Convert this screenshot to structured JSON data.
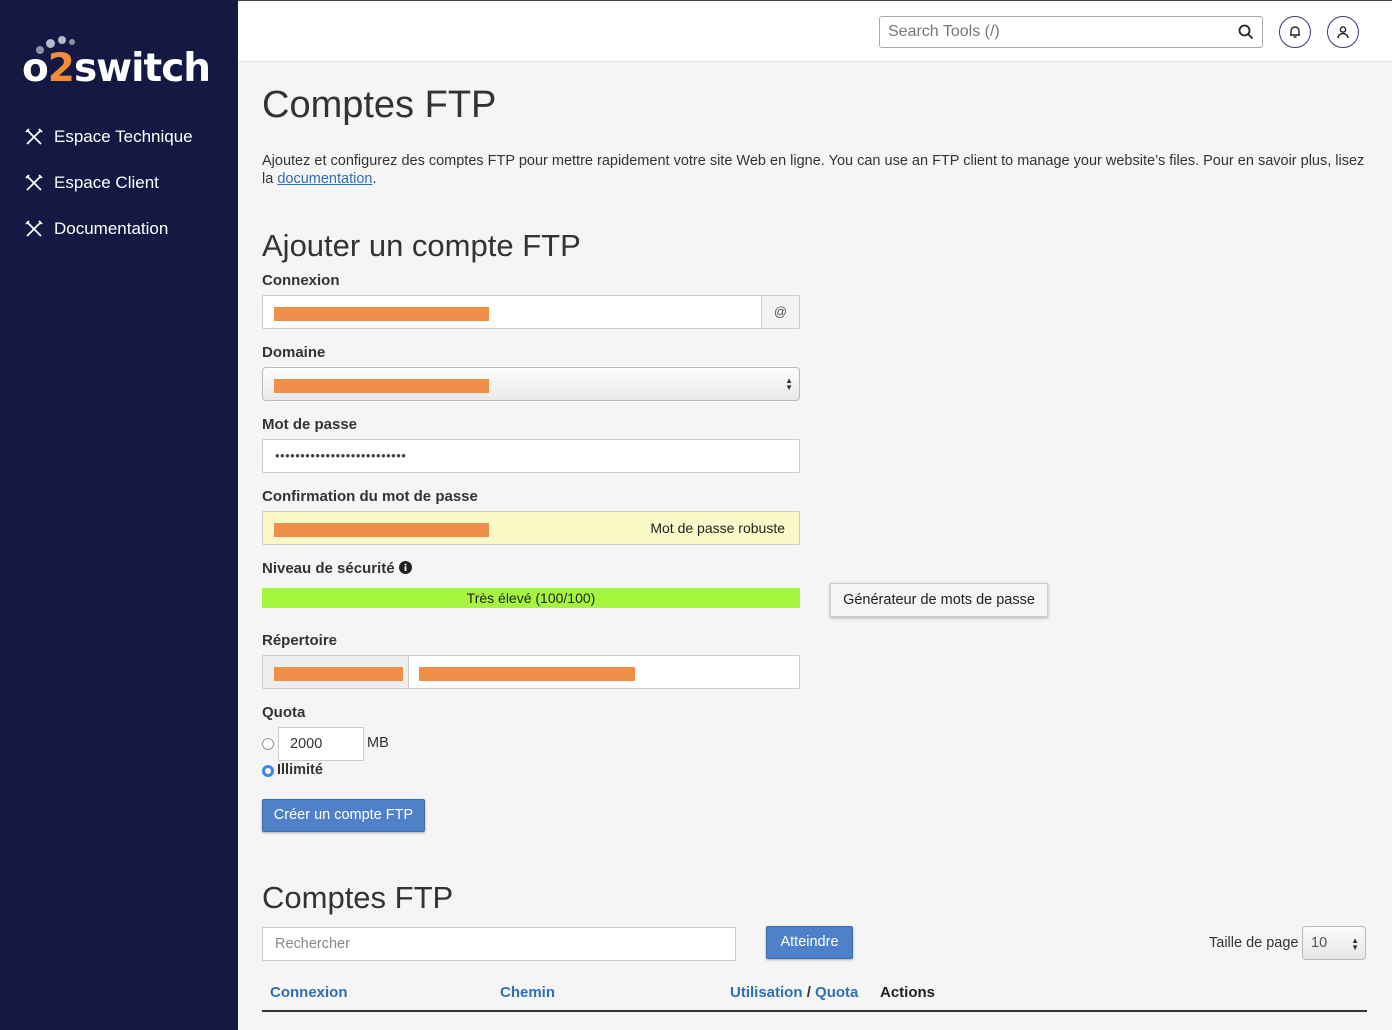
{
  "brand": {
    "logo_text_a": "o",
    "logo_text_b": "2",
    "logo_text_c": "switch",
    "accent": "#f28b3a",
    "sidebar_bg": "#131942"
  },
  "sidebar": {
    "items": [
      {
        "label": "Espace Technique",
        "icon": "tools-icon"
      },
      {
        "label": "Espace Client",
        "icon": "tools-icon"
      },
      {
        "label": "Documentation",
        "icon": "tools-icon"
      }
    ]
  },
  "topbar": {
    "search_placeholder": "Search Tools (/)",
    "notification_icon": "bell-icon",
    "user_icon": "user-icon"
  },
  "page": {
    "title": "Comptes FTP",
    "intro_text": "Ajoutez et configurez des comptes FTP pour mettre rapidement votre site Web en ligne. You can use an FTP client to manage your website’s files. Pour en savoir plus, lisez la ",
    "intro_link": "documentation",
    "intro_end": "."
  },
  "add_form": {
    "heading": "Ajouter un compte FTP",
    "login_label": "Connexion",
    "login_addon": "@",
    "domain_label": "Domaine",
    "password_label": "Mot de passe",
    "password_value": "••••••••••••••••••••••••••",
    "confirm_label": "Confirmation du mot de passe",
    "confirm_status": "Mot de passe robuste",
    "security_label": "Niveau de sécurité",
    "security_value": "Très élevé (100/100)",
    "security_score": 100,
    "generator_button": "Générateur de mots de passe",
    "directory_label": "Répertoire",
    "quota_label": "Quota",
    "quota_value": "2000",
    "quota_unit": "MB",
    "unlimited_label": "Illimité",
    "submit_button": "Créer un compte FTP"
  },
  "accounts": {
    "heading": "Comptes FTP",
    "search_placeholder": "Rechercher",
    "go_button": "Atteindre",
    "page_size_label": "Taille de page",
    "page_size_value": "10",
    "columns": {
      "login": "Connexion",
      "path": "Chemin",
      "usage": "Utilisation",
      "sep": "/",
      "quota": "Quota",
      "actions": "Actions"
    }
  }
}
